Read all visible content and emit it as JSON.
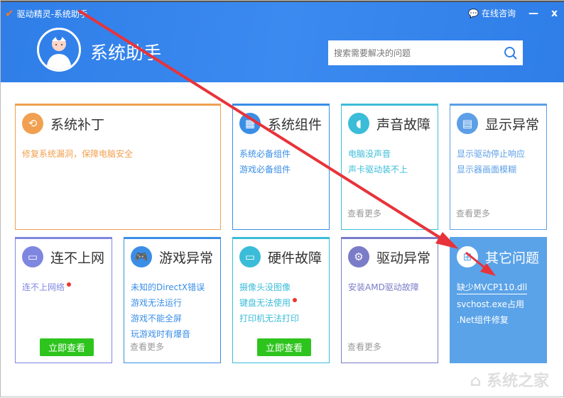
{
  "window": {
    "title": "驱动精灵-系统助手",
    "consult": "在线咨询",
    "minimize": "—",
    "close": "x"
  },
  "header": {
    "app_title": "系统助手",
    "search_placeholder": "搜索需要解决的问题"
  },
  "cards": [
    {
      "title": "系统补丁",
      "color": "#f0a050",
      "links": [
        "修复系统漏洞，保障电脑安全"
      ]
    },
    {
      "title": "系统组件",
      "color": "#3a8ee6",
      "links": [
        "系统必备组件",
        "游戏必备组件"
      ]
    },
    {
      "title": "声音故障",
      "color": "#3bbcd8",
      "links": [
        "电脑没声音",
        "声卡驱动装不上"
      ],
      "more": "查看更多"
    },
    {
      "title": "显示异常",
      "color": "#5c9fe6",
      "links": [
        "显示驱动停止响应",
        "显示器画面模糊"
      ],
      "more": "查看更多"
    },
    {
      "title": "连不上网",
      "color": "#7f86e0",
      "links": [
        "连不上网络"
      ],
      "button": "立即查看"
    },
    {
      "title": "游戏异常",
      "color": "#3a8ee6",
      "links": [
        "未知的DirectX错误",
        "游戏无法运行",
        "游戏不能全屏",
        "玩游戏时有爆音"
      ],
      "more": "查看更多"
    },
    {
      "title": "硬件故障",
      "color": "#3bbcd8",
      "links": [
        "摄像头没图像",
        "键盘无法使用",
        "打印机无法打印"
      ],
      "button": "立即查看"
    },
    {
      "title": "驱动异常",
      "color": "#7a7cc8",
      "links": [
        "安装AMD驱动故障"
      ],
      "more": "查看更多"
    },
    {
      "title": "其它问题",
      "color": "#5ba3e8",
      "links": [
        "缺少MVCP110.dll",
        "svchost.exe占用",
        ".Net组件修复"
      ]
    }
  ],
  "watermark": "系统之家"
}
